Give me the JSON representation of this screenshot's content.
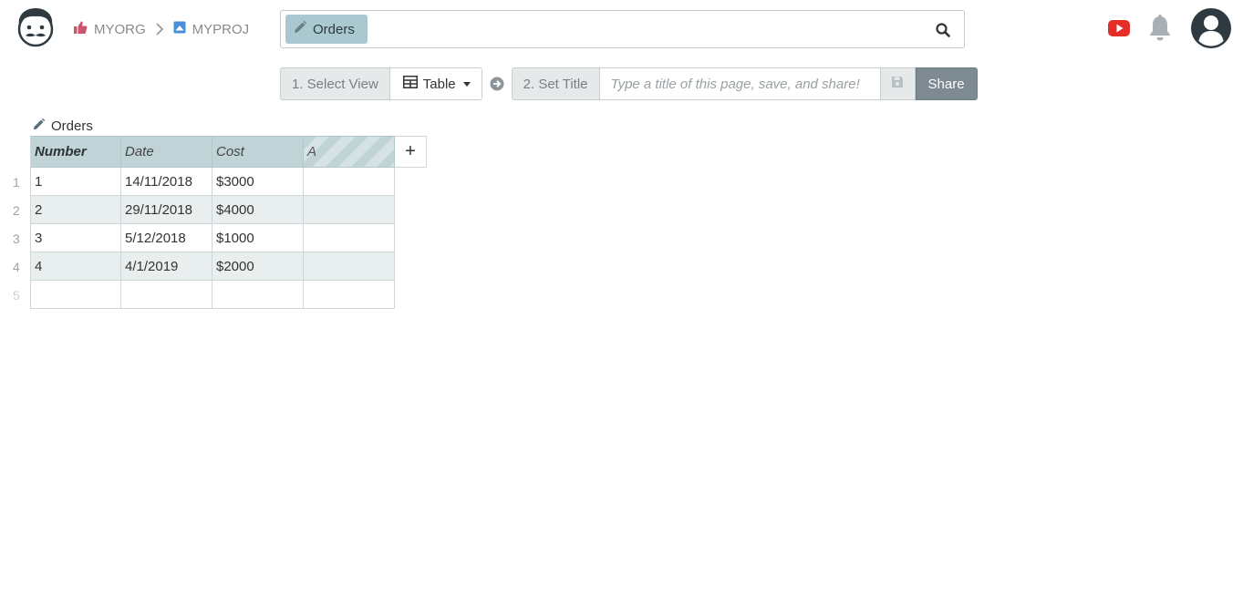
{
  "breadcrumb": {
    "org": "MYORG",
    "project": "MYPROJ"
  },
  "search": {
    "chip_label": "Orders"
  },
  "toolbar": {
    "step1_label": "1. Select View",
    "view_value": "Table",
    "step2_label": "2. Set Title",
    "title_placeholder": "Type a title of this page, save, and share!",
    "share_label": "Share"
  },
  "table": {
    "name": "Orders",
    "columns": [
      "Number",
      "Date",
      "Cost",
      "A"
    ],
    "rows": [
      {
        "num": "1",
        "cells": [
          "1",
          "14/11/2018",
          "$3000",
          ""
        ]
      },
      {
        "num": "2",
        "cells": [
          "2",
          "29/11/2018",
          "$4000",
          ""
        ]
      },
      {
        "num": "3",
        "cells": [
          "3",
          "5/12/2018",
          "$1000",
          ""
        ]
      },
      {
        "num": "4",
        "cells": [
          "4",
          "4/1/2019",
          "$2000",
          ""
        ]
      },
      {
        "num": "5",
        "cells": [
          "",
          "",
          "",
          ""
        ]
      }
    ],
    "add_column_label": "+"
  },
  "colors": {
    "accent_chip": "#a9c8d0",
    "header_bg": "#c0d4d8",
    "share_bg": "#7d8a92",
    "youtube_red": "#e52d27",
    "org_icon": "#c9556e",
    "proj_icon": "#4a90d9"
  },
  "icons": {
    "logo": "mustache-face-icon",
    "org": "thumbs-up-icon",
    "separator": "chevron-right-icon",
    "project": "image-icon",
    "chip": "pencil-icon",
    "search": "search-icon",
    "youtube": "youtube-icon",
    "notifications": "bell-icon",
    "account": "user-circle-icon",
    "view": "table-icon",
    "next": "arrow-circle-right-icon",
    "save": "floppy-disk-icon",
    "table_title": "pencil-icon"
  }
}
